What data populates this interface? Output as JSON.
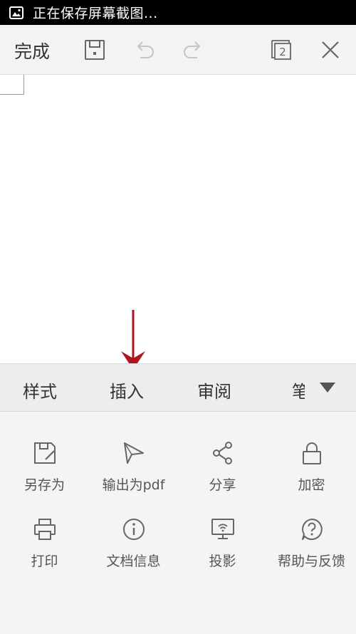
{
  "status_bar": {
    "text": "正在保存屏幕截图..."
  },
  "toolbar": {
    "done_label": "完成",
    "save_icon": "save-icon",
    "undo_icon": "undo-icon",
    "redo_icon": "redo-icon",
    "window_count": "2",
    "close_icon": "close-icon"
  },
  "tabs": [
    {
      "label": "样式"
    },
    {
      "label": "插入"
    },
    {
      "label": "审阅"
    },
    {
      "label": "笔"
    }
  ],
  "menu": {
    "items": [
      {
        "label": "另存为",
        "icon": "save-as-icon"
      },
      {
        "label": "输出为pdf",
        "icon": "export-pdf-icon"
      },
      {
        "label": "分享",
        "icon": "share-icon"
      },
      {
        "label": "加密",
        "icon": "lock-icon"
      },
      {
        "label": "打印",
        "icon": "print-icon"
      },
      {
        "label": "文档信息",
        "icon": "info-icon"
      },
      {
        "label": "投影",
        "icon": "projection-icon"
      },
      {
        "label": "帮助与反馈",
        "icon": "help-icon"
      }
    ]
  },
  "colors": {
    "annotation_arrow": "#b3121f",
    "icon_active": "#666666",
    "icon_disabled": "#c4c4c4"
  }
}
